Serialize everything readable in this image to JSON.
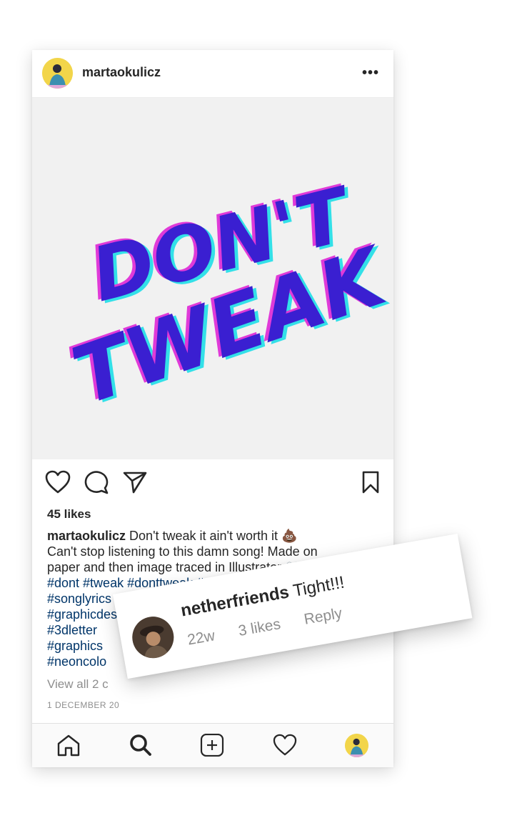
{
  "post": {
    "username": "martaokulicz",
    "more_icon": "more-horizontal-icon",
    "image_text": [
      "DON'T",
      "TWEAK"
    ],
    "likes": "45 likes",
    "caption": {
      "username": "martaokulicz",
      "lines": [
        " Don't tweak it ain't worth it 💩",
        "Can't stop listening to this damn song! Made on",
        "paper and then image traced in Illustrator 👀"
      ],
      "hashtag_lines": [
        "#dont #tweak #donttweak #netherf",
        "#songlyrics #lettering #l",
        "#graphicdesi",
        "#3dletter",
        "#graphics",
        "#neoncolo"
      ]
    },
    "view_all": "View all 2 c",
    "date": "1 DECEMBER 20"
  },
  "comment": {
    "username": "netherfriends",
    "text": " Tight!!!",
    "age": "22w",
    "likes": "3 likes",
    "reply": "Reply"
  },
  "icons": {
    "actions": [
      "heart-icon",
      "comment-icon",
      "share-icon",
      "bookmark-icon"
    ],
    "tabs": [
      "home-icon",
      "search-icon",
      "add-post-icon",
      "activity-heart-icon",
      "profile-avatar"
    ]
  },
  "colors": {
    "hashtag": "#003569",
    "lettering": "#3a1fd1",
    "lettering_magenta": "#e03ad8",
    "lettering_cyan": "#33e0e8",
    "image_bg": "#f1f1f1"
  }
}
